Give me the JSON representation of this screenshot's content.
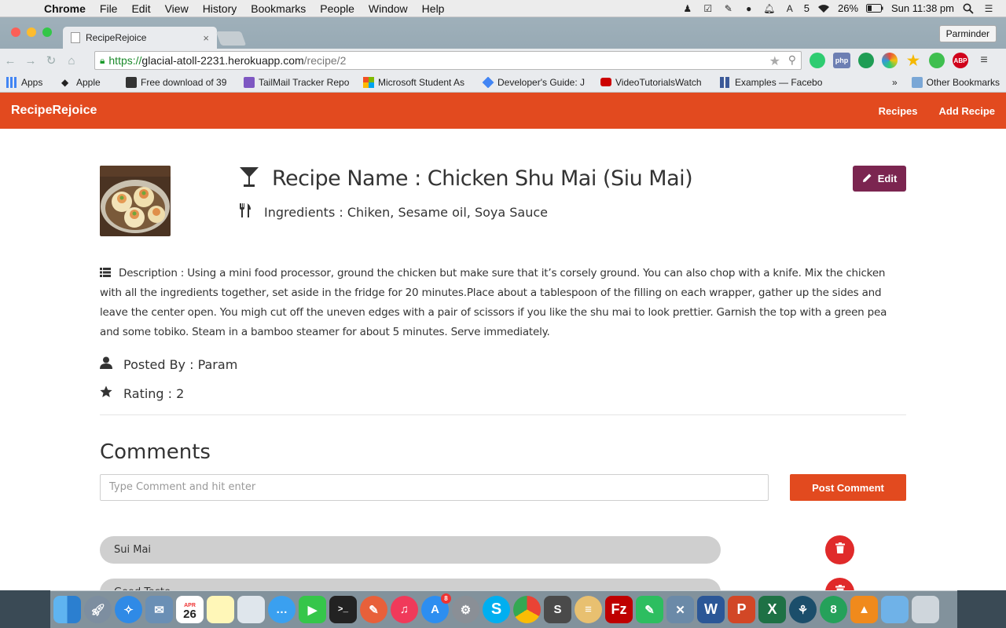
{
  "menubar": {
    "app_name": "Chrome",
    "menus": [
      "File",
      "Edit",
      "View",
      "History",
      "Bookmarks",
      "People",
      "Window",
      "Help"
    ],
    "status_number": "5",
    "battery": "26%",
    "clock": "Sun 11:38 pm"
  },
  "browser": {
    "tab_title": "RecipeRejoice",
    "profile_name": "Parminder",
    "url_scheme": "https://",
    "url_host": "glacial-atoll-2231.herokuapp.com",
    "url_path": "/recipe/2",
    "ext_php": "php",
    "ext_abp": "ABP",
    "bookmarks": [
      {
        "label": "Apps",
        "color": "#4285f4"
      },
      {
        "label": "Apple",
        "color": "#555555"
      },
      {
        "label": "Free download of 39",
        "color": "#333333"
      },
      {
        "label": "TailMail Tracker Repo",
        "color": "#7e57c2"
      },
      {
        "label": "Microsoft Student As",
        "color": "#f25022"
      },
      {
        "label": "Developer's Guide: J",
        "color": "#4285f4"
      },
      {
        "label": "VideoTutorialsWatch",
        "color": "#cc0000"
      },
      {
        "label": "Examples — Facebo",
        "color": "#3b5998"
      }
    ],
    "bookmarks_more": "»",
    "other_bookmarks": "Other Bookmarks"
  },
  "app": {
    "brand": "RecipeRejoice",
    "nav": {
      "recipes": "Recipes",
      "add_recipe": "Add Recipe"
    },
    "brand_color": "#e24a1f"
  },
  "recipe": {
    "title": "Recipe Name : Chicken Shu Mai (Siu Mai)",
    "ingredients": "Ingredients : Chiken, Sesame oil, Soya Sauce",
    "edit_label": "Edit",
    "description": "Description : Using a mini food processor, ground the chicken but make sure that it’s corsely ground. You can also chop with a knife. Mix the chicken with all the ingredients together, set aside in the fridge for 20 minutes.Place about a tablespoon of the filling on each wrapper, gather up the sides and leave the center open. You migh cut off the uneven edges with a pair of scissors if you like the shu mai to look prettier. Garnish the top with a green pea and some tobiko. Steam in a bamboo steamer for about 5 minutes. Serve immediately.",
    "posted_by": "Posted By : Param",
    "rating": "Rating : 2"
  },
  "comments": {
    "heading": "Comments",
    "input_placeholder": "Type Comment and hit enter",
    "post_label": "Post Comment",
    "items": [
      {
        "text": "Sui Mai"
      },
      {
        "text": "Good Taste"
      }
    ]
  },
  "dock": {
    "calendar_month": "APR",
    "calendar_day": "26",
    "appstore_badge": "8"
  }
}
